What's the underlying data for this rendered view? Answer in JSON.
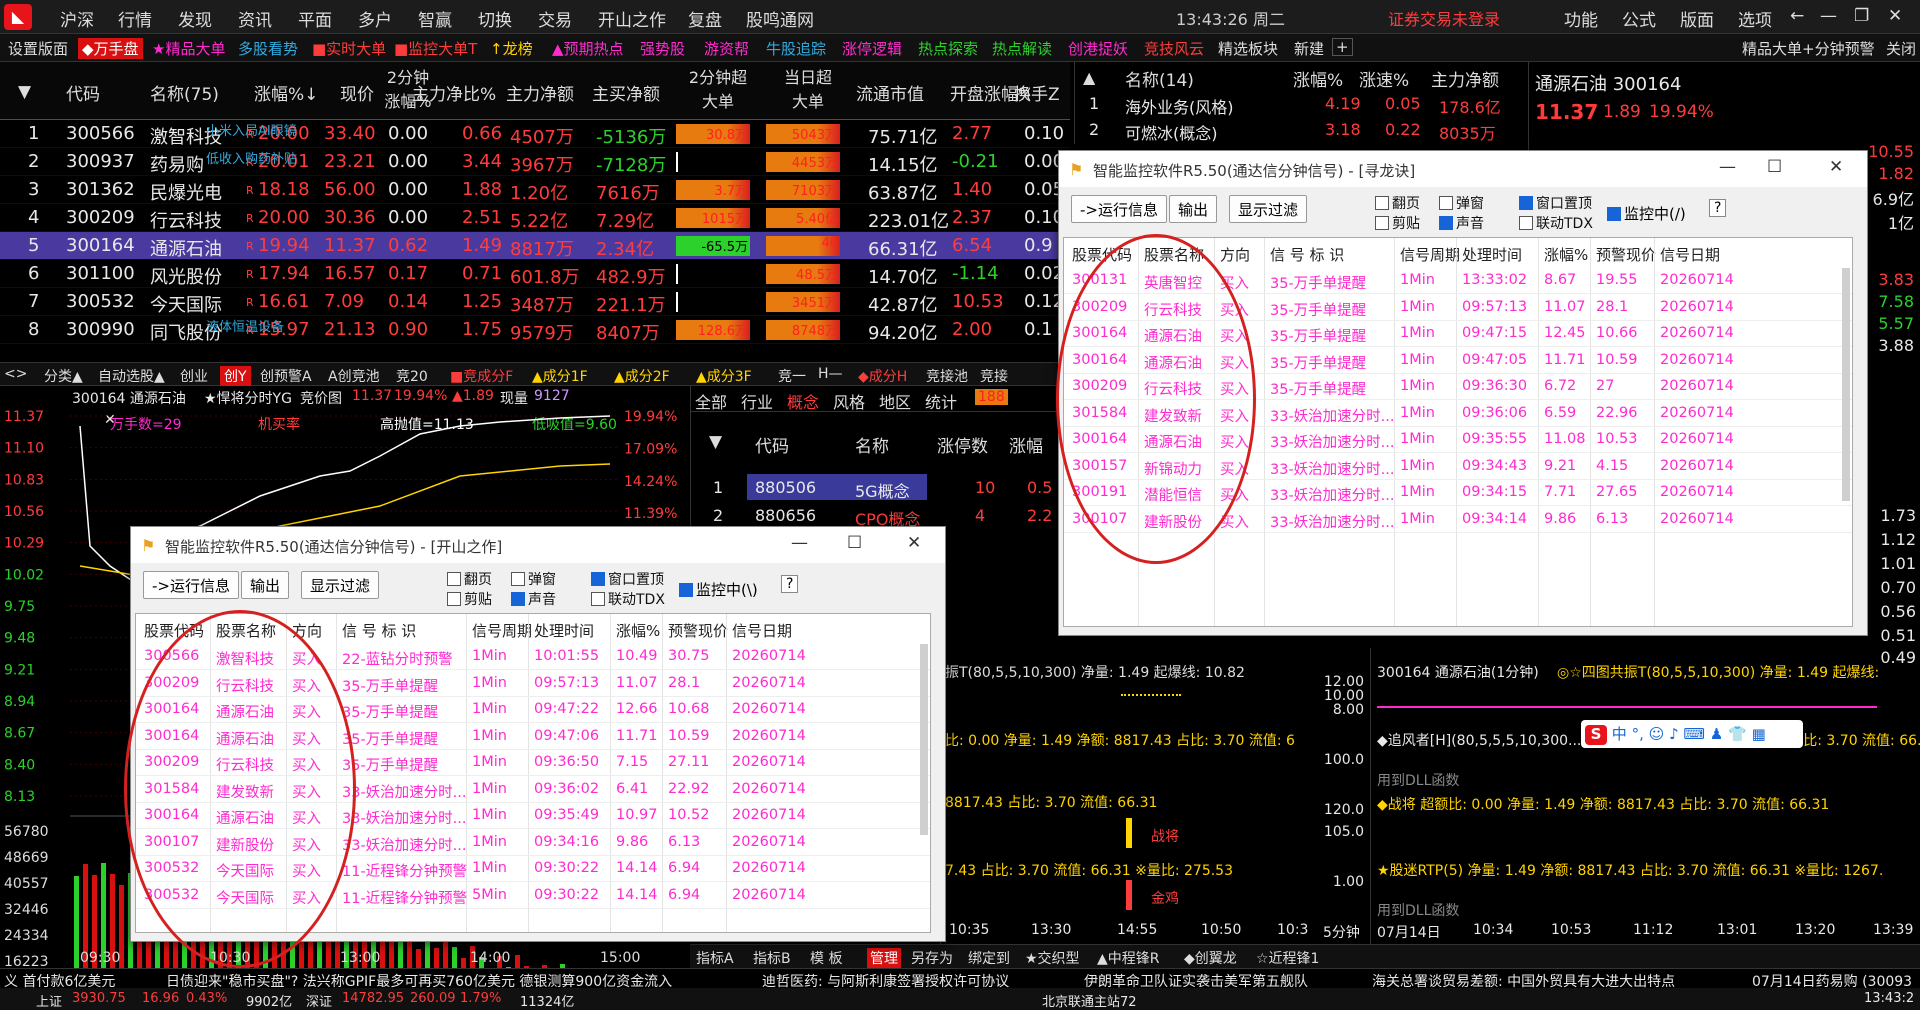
{
  "menubar": {
    "items": [
      "沪深",
      "行情",
      "发现",
      "资讯",
      "平面",
      "多户",
      "智赢",
      "切换",
      "交易",
      "开山之作",
      "复盘",
      "股鸣通网"
    ],
    "clock": "13:43:26 周二",
    "login_status": "证券交易未登录",
    "right": [
      "功能",
      "公式",
      "版面",
      "选项"
    ]
  },
  "toolbar": {
    "items": [
      "设置版面",
      "◆万手盘",
      "★精品大单",
      "多股看势",
      "■实时大单",
      "■监控大单T",
      "↑龙榜",
      "▲预期热点",
      "强势股",
      "游资帮",
      "牛股追踪",
      "涨停逻辑",
      "热点探索",
      "热点解读",
      "创港捉妖",
      "竞技风云",
      "精选板块",
      "新建"
    ],
    "right": "精品大单+分钟预警",
    "close": "关闭"
  },
  "main_table": {
    "headers": [
      "代码",
      "名称(75)",
      "涨幅%↓",
      "现价",
      "2分钟涨幅%",
      "主力净比%",
      "主力净额",
      "主买净额",
      "2分钟超大单",
      "当日超大单",
      "流通市值",
      "开盘涨幅%",
      "换手Z"
    ],
    "rows": [
      {
        "idx": "1",
        "code": "300566",
        "name": "激智科技",
        "note": "小米入局AI眼镜",
        "pct": "20.00",
        "price": "33.40",
        "m2": "0.00",
        "ratio": "0.66",
        "net": "4507万",
        "buy": "-5136万",
        "s2": "30.8万",
        "day": "5043万",
        "cap": "75.71亿",
        "open": "2.77",
        "turn": "0.10"
      },
      {
        "idx": "2",
        "code": "300937",
        "name": "药易购",
        "note": "低收入购药补贴",
        "pct": "20.01",
        "price": "23.21",
        "m2": "0.00",
        "ratio": "3.44",
        "net": "3967万",
        "buy": "-7128万",
        "s2": "",
        "day": "4453万",
        "cap": "14.15亿",
        "open": "-0.21",
        "turn": "0.00"
      },
      {
        "idx": "3",
        "code": "301362",
        "name": "民爆光电",
        "note": "",
        "pct": "18.18",
        "price": "56.00",
        "m2": "0.00",
        "ratio": "1.88",
        "net": "1.20亿",
        "buy": "7616万",
        "s2": "3.7万",
        "day": "7103万",
        "cap": "63.87亿",
        "open": "1.40",
        "turn": "0.05"
      },
      {
        "idx": "4",
        "code": "300209",
        "name": "行云科技",
        "note": "",
        "pct": "20.00",
        "price": "30.36",
        "m2": "0.00",
        "ratio": "2.51",
        "net": "5.22亿",
        "buy": "7.29亿",
        "s2": "1015万",
        "day": "5.40亿",
        "cap": "223.01亿",
        "open": "2.37",
        "turn": "0.10"
      },
      {
        "idx": "5",
        "code": "300164",
        "name": "通源石油",
        "note": "",
        "pct": "19.94",
        "price": "11.37",
        "m2": "0.62",
        "ratio": "1.49",
        "net": "8817万",
        "buy": "2.34亿",
        "s2": "-65.5万",
        "day": "46",
        "cap": "66.31亿",
        "open": "6.54",
        "turn": "0.9"
      },
      {
        "idx": "6",
        "code": "301100",
        "name": "风光股份",
        "note": "",
        "pct": "17.94",
        "price": "16.57",
        "m2": "0.17",
        "ratio": "0.71",
        "net": "601.8万",
        "buy": "482.9万",
        "s2": "",
        "day": "48.5万",
        "cap": "14.70亿",
        "open": "-1.14",
        "turn": "0.02"
      },
      {
        "idx": "7",
        "code": "300532",
        "name": "今天国际",
        "note": "",
        "pct": "16.61",
        "price": "7.09",
        "m2": "0.14",
        "ratio": "1.25",
        "net": "3487万",
        "buy": "221.1万",
        "s2": "",
        "day": "3451万",
        "cap": "42.87亿",
        "open": "10.53",
        "turn": "0.12"
      },
      {
        "idx": "8",
        "code": "300990",
        "name": "同飞股份",
        "note": "液体恒温设备",
        "pct": "15.97",
        "price": "21.13",
        "m2": "0.90",
        "ratio": "1.75",
        "net": "9579万",
        "buy": "8407万",
        "s2": "128.6万",
        "day": "8748万",
        "cap": "94.20亿",
        "open": "2.00",
        "turn": "0.1"
      }
    ]
  },
  "sector_panel": {
    "headers": [
      "名称(14)",
      "涨幅%",
      "涨速%",
      "主力净额"
    ],
    "rows": [
      {
        "idx": "1",
        "name": "海外业务(风格)",
        "pct": "4.19",
        "spd": "0.05",
        "net": "178.6亿"
      },
      {
        "idx": "2",
        "name": "可燃冰(概念)",
        "pct": "3.18",
        "spd": "0.22",
        "net": "8035万"
      }
    ]
  },
  "quote_panel": {
    "title": "通源石油 300164",
    "price": "11.37",
    "chg": "1.89",
    "pct": "19.94%"
  },
  "tabbar": [
    "<>",
    "分类▲",
    "自动选股▲",
    "创业",
    "创Y",
    "创预警A",
    "A创竞池",
    "竞20",
    "■竞成分F",
    "▲成分1F",
    "▲成分2F",
    "▲成分3F",
    "竞一",
    "H—",
    "◆成分H",
    "竞接池",
    "竞接"
  ],
  "chart": {
    "title": "300164 通源石油",
    "flag": "★悍将分时YG",
    "bid": "竞价图",
    "price": "11.37",
    "pct": "19.94%",
    "chg": "▲1.89",
    "vol_label": "现量",
    "vol": "9127",
    "wan": "万手数=29",
    "jimai": "机买率",
    "high": "高抛值=11.13",
    "low": "低吸值=9.60",
    "y_left": [
      "11.37",
      "11.10",
      "10.83",
      "10.56",
      "10.29",
      "10.02",
      "9.75",
      "9.48",
      "9.21",
      "8.94",
      "8.67",
      "8.40",
      "8.13"
    ],
    "y_right": [
      "19.94%",
      "17.09%",
      "14.24%",
      "11.39%",
      "8.54%"
    ],
    "vol_axis": [
      "56780",
      "48669",
      "40557",
      "32446",
      "24334",
      "16223",
      "8111"
    ],
    "x": [
      "09:30",
      "10:30",
      "13:00",
      "14:00",
      "15:00"
    ]
  },
  "board_panel": {
    "tabs": [
      "全部",
      "行业",
      "概念",
      "风格",
      "地区",
      "统计"
    ],
    "count": "188",
    "headers": [
      "代码",
      "名称",
      "涨停数",
      "涨幅"
    ],
    "rows": [
      {
        "idx": "1",
        "code": "880506",
        "name": "5G概念",
        "up": "10",
        "pct": "0.5"
      },
      {
        "idx": "2",
        "code": "880656",
        "name": "CPO概念",
        "up": "4",
        "pct": "2.2"
      }
    ]
  },
  "dialog1": {
    "title": "智能监控软件R5.50(通达信分钟信号) - [寻龙诀]",
    "buttons": [
      "->运行信息",
      "输出",
      "显示过滤"
    ],
    "checks": [
      {
        "label": "翻页",
        "on": false
      },
      {
        "label": "弹窗",
        "on": false
      },
      {
        "label": "窗口置顶",
        "on": true
      },
      {
        "label": "剪贴",
        "on": false
      },
      {
        "label": "声音",
        "on": true
      },
      {
        "label": "联动TDX",
        "on": false
      }
    ],
    "monitor": "监控中(/)",
    "help": "?",
    "headers": [
      "股票代码",
      "股票名称",
      "方向",
      "信 号 标 识",
      "信号周期",
      "处理时间",
      "涨幅%",
      "预警现价",
      "信号日期"
    ],
    "rows": [
      [
        "300131",
        "英唐智控",
        "买入",
        "35-万手单提醒",
        "1Min",
        "13:33:02",
        "8.67",
        "19.55",
        "20260714"
      ],
      [
        "300209",
        "行云科技",
        "买入",
        "35-万手单提醒",
        "1Min",
        "09:57:13",
        "11.07",
        "28.1",
        "20260714"
      ],
      [
        "300164",
        "通源石油",
        "买入",
        "35-万手单提醒",
        "1Min",
        "09:47:15",
        "12.45",
        "10.66",
        "20260714"
      ],
      [
        "300164",
        "通源石油",
        "买入",
        "35-万手单提醒",
        "1Min",
        "09:47:05",
        "11.71",
        "10.59",
        "20260714"
      ],
      [
        "300209",
        "行云科技",
        "买入",
        "35-万手单提醒",
        "1Min",
        "09:36:30",
        "6.72",
        "27",
        "20260714"
      ],
      [
        "301584",
        "建发致新",
        "买入",
        "33-妖治加速分时...",
        "1Min",
        "09:36:06",
        "6.59",
        "22.96",
        "20260714"
      ],
      [
        "300164",
        "通源石油",
        "买入",
        "33-妖治加速分时...",
        "1Min",
        "09:35:55",
        "11.08",
        "10.53",
        "20260714"
      ],
      [
        "300157",
        "新锦动力",
        "买入",
        "33-妖治加速分时...",
        "1Min",
        "09:34:43",
        "9.21",
        "4.15",
        "20260714"
      ],
      [
        "300191",
        "潜能恒信",
        "买入",
        "33-妖治加速分时...",
        "1Min",
        "09:34:15",
        "7.71",
        "27.65",
        "20260714"
      ],
      [
        "300107",
        "建新股份",
        "买入",
        "33-妖治加速分时...",
        "1Min",
        "09:34:14",
        "9.86",
        "6.13",
        "20260714"
      ]
    ]
  },
  "dialog2": {
    "title": "智能监控软件R5.50(通达信分钟信号) - [开山之作]",
    "buttons": [
      "->运行信息",
      "输出",
      "显示过滤"
    ],
    "checks": [
      {
        "label": "翻页",
        "on": false
      },
      {
        "label": "弹窗",
        "on": false
      },
      {
        "label": "窗口置顶",
        "on": true
      },
      {
        "label": "剪贴",
        "on": false
      },
      {
        "label": "声音",
        "on": true
      },
      {
        "label": "联动TDX",
        "on": false
      }
    ],
    "monitor": "监控中(\\)",
    "help": "?",
    "headers": [
      "股票代码",
      "股票名称",
      "方向",
      "信 号 标 识",
      "信号周期",
      "处理时间",
      "涨幅%",
      "预警现价",
      "信号日期"
    ],
    "rows": [
      [
        "300566",
        "激智科技",
        "买入",
        "22-蓝钻分时预警",
        "1Min",
        "10:01:55",
        "10.49",
        "30.75",
        "20260714"
      ],
      [
        "300209",
        "行云科技",
        "买入",
        "35-万手单提醒",
        "1Min",
        "09:57:13",
        "11.07",
        "28.1",
        "20260714"
      ],
      [
        "300164",
        "通源石油",
        "买入",
        "35-万手单提醒",
        "1Min",
        "09:47:22",
        "12.66",
        "10.68",
        "20260714"
      ],
      [
        "300164",
        "通源石油",
        "买入",
        "35-万手单提醒",
        "1Min",
        "09:47:06",
        "11.71",
        "10.59",
        "20260714"
      ],
      [
        "300209",
        "行云科技",
        "买入",
        "35-万手单提醒",
        "1Min",
        "09:36:50",
        "7.15",
        "27.11",
        "20260714"
      ],
      [
        "301584",
        "建发致新",
        "买入",
        "33-妖治加速分时...",
        "1Min",
        "09:36:02",
        "6.41",
        "22.92",
        "20260714"
      ],
      [
        "300164",
        "通源石油",
        "买入",
        "33-妖治加速分时...",
        "1Min",
        "09:35:49",
        "10.97",
        "10.52",
        "20260714"
      ],
      [
        "300107",
        "建新股份",
        "买入",
        "33-妖治加速分时...",
        "1Min",
        "09:34:16",
        "9.86",
        "6.13",
        "20260714"
      ],
      [
        "300532",
        "今天国际",
        "买入",
        "11-近程锋分钟预警",
        "1Min",
        "09:30:22",
        "14.14",
        "6.94",
        "20260714"
      ],
      [
        "300532",
        "今天国际",
        "买入",
        "11-近程锋分钟预警",
        "5Min",
        "09:30:22",
        "14.14",
        "6.94",
        "20260714"
      ]
    ]
  },
  "indicators": {
    "mid1": "振T(80,5,5,10,300) 净量: 1.49 起爆线: 10.82",
    "mid2": "比: 0.00 净量: 1.49 净额: 8817.43 占比: 3.70 流值: 6",
    "mid3": "8817.43 占比: 3.70 流值: 66.31",
    "mid4": "7.43 占比: 3.70 流值: 66.31 ※量比: 275.53",
    "mid_tag1": "战将",
    "mid_tag2": "金鸡",
    "mid_axis": [
      "12.00",
      "10.00",
      "8.00",
      "100.0",
      "120.0",
      "105.0",
      "1.00"
    ],
    "mid_x": [
      "10:35",
      "13:30",
      "14:55",
      "10:50",
      "10:3"
    ],
    "mid_period": "5分钟",
    "r_title": "300164 通源石油(1分钟)",
    "r1": "◎☆四图共振T(80,5,5,10,300) 净量: 1.49 起爆线:",
    "r2": "◆追风者[H](80,5,5,5,10,300...",
    "r2b": "43 占比: 3.70 流值: 66.31",
    "r3": "用到DLL函数",
    "r4": "◆战将 超额比: 0.00 净量: 1.49 净额: 8817.43 占比: 3.70 流值: 66.31",
    "r5": "★股迷RTP(5) 净量: 1.49 净额: 8817.43 占比: 3.70 流值: 66.31 ※量比: 1267.",
    "r6": "用到DLL函数",
    "r_x": [
      "07月14日",
      "10:34",
      "10:53",
      "11:12",
      "13:01",
      "13:20",
      "13:39"
    ],
    "r_right": [
      "1.73",
      "1.12",
      "1.01",
      "0.70",
      "0.56",
      "0.51",
      "0.49",
      "7.58",
      "5.57",
      "3.88",
      "3.83"
    ],
    "r_top_right": [
      "10.55",
      "1.82",
      "6.9亿",
      "1亿"
    ]
  },
  "bottom_toolbar": [
    "指标A",
    "指标B",
    "模 板",
    "管理",
    "另存为",
    "绑定到",
    "★交织型",
    "▲中程锋R",
    "◆创翼龙",
    "☆近程锋1"
  ],
  "ime": [
    "中",
    "°,",
    "☺",
    "♪",
    "⌨",
    "♟",
    "👕",
    "▦"
  ],
  "news": [
    "义 首付款6亿美元",
    "日债迎来\"稳市买盘\"? 法兴称GPIF最多可再买760亿美元 德银测算900亿资金流入",
    "迪哲医药: 与阿斯利康签署授权许可协议",
    "伊朗革命卫队证实袭击美军第五舰队",
    "海关总署谈贸易差额: 中国外贸具有大进大出特点",
    "07月14日药易购 (30093"
  ],
  "status": {
    "index": "上证",
    "v1": "3930.75",
    "v2": "16.96",
    "v3": "0.43%",
    "v4": "9902亿",
    "s2": "深证",
    "v5": "14782.95",
    "v6": "260.09",
    "v7": "1.79%",
    "v8": "11324亿",
    "net": "北京联通主站72",
    "time": "13:43:2"
  },
  "colors": {
    "rise": "#ff3c3c",
    "fall": "#2cd12c",
    "highlight_row": "#4a3aa0",
    "alert": "#ff2bd0",
    "circle": "#d52020"
  }
}
